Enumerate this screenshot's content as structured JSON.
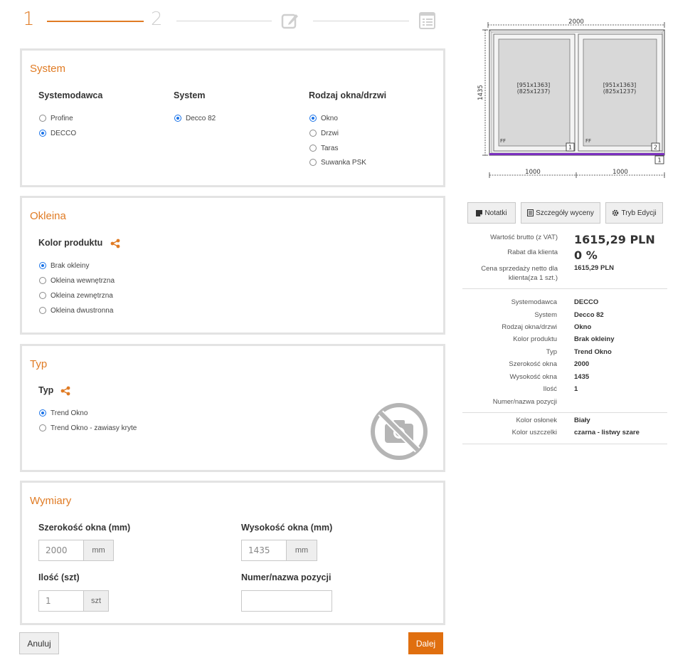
{
  "steps": {
    "step1": "1",
    "step2": "2"
  },
  "system_panel": {
    "title": "System",
    "systemodawca": {
      "label": "Systemodawca",
      "options": [
        "Profine",
        "DECCO"
      ],
      "selected": "DECCO"
    },
    "system": {
      "label": "System",
      "options": [
        "Decco 82"
      ],
      "selected": "Decco 82"
    },
    "rodzaj": {
      "label": "Rodzaj okna/drzwi",
      "options": [
        "Okno",
        "Drzwi",
        "Taras",
        "Suwanka PSK"
      ],
      "selected": "Okno"
    }
  },
  "okleina_panel": {
    "title": "Okleina",
    "kolor": {
      "label": "Kolor produktu",
      "options": [
        "Brak okleiny",
        "Okleina wewnętrzna",
        "Okleina zewnętrzna",
        "Okleina dwustronna"
      ],
      "selected": "Brak okleiny"
    }
  },
  "typ_panel": {
    "title": "Typ",
    "typ": {
      "label": "Typ",
      "options": [
        "Trend Okno",
        "Trend Okno - zawiasy kryte"
      ],
      "selected": "Trend Okno"
    }
  },
  "wymiary_panel": {
    "title": "Wymiary",
    "szerokosc": {
      "label": "Szerokość okna (mm)",
      "value": "2000",
      "unit": "mm"
    },
    "wysokosc": {
      "label": "Wysokość okna (mm)",
      "value": "1435",
      "unit": "mm"
    },
    "ilosc": {
      "label": "Ilość (szt)",
      "value": "1",
      "unit": "szt"
    },
    "numer": {
      "label": "Numer/nazwa pozycji",
      "value": ""
    }
  },
  "buttons": {
    "cancel": "Anuluj",
    "next": "Dalej"
  },
  "preview": {
    "total_width": "2000",
    "total_height": "1435",
    "sash_left_dims": [
      "[951x1363]",
      "(825x1237)"
    ],
    "sash_right_dims": [
      "[951x1363]",
      "(825x1237)"
    ],
    "ff_left": "FF",
    "ff_right": "FF",
    "marker_left": "1",
    "marker_right": "2",
    "marker_frame": "1",
    "segment_left": "1000",
    "segment_right": "1000"
  },
  "toolbar": {
    "notes": "Notatki",
    "details": "Szczegóły wyceny",
    "edit_mode": "Tryb Edycji"
  },
  "pricing": {
    "gross_label": "Wartość brutto (z VAT)",
    "gross_value": "1615,29 PLN",
    "discount_label": "Rabat dla klienta",
    "discount_value": "0 %",
    "net_label": "Cena sprzedaży netto dla klienta(za 1 szt.)",
    "net_value": "1615,29 PLN"
  },
  "summary": [
    {
      "label": "Systemodawca",
      "value": "DECCO"
    },
    {
      "label": "System",
      "value": "Decco 82"
    },
    {
      "label": "Rodzaj okna/drzwi",
      "value": "Okno"
    },
    {
      "label": "Kolor produktu",
      "value": "Brak okleiny"
    },
    {
      "label": "Typ",
      "value": "Trend Okno"
    },
    {
      "label": "Szerokość okna",
      "value": "2000"
    },
    {
      "label": "Wysokość okna",
      "value": "1435"
    },
    {
      "label": "Ilość",
      "value": "1"
    },
    {
      "label": "Numer/nazwa pozycji",
      "value": ""
    }
  ],
  "extras": [
    {
      "label": "Kolor osłonek",
      "value": "Biały"
    },
    {
      "label": "Kolor uszczelki",
      "value": "czarna - listwy szare"
    }
  ],
  "colors": {
    "accent": "#e07b24",
    "button": "#e06f0f",
    "radio": "#1a73e8",
    "sill": "#7b2fbe"
  }
}
